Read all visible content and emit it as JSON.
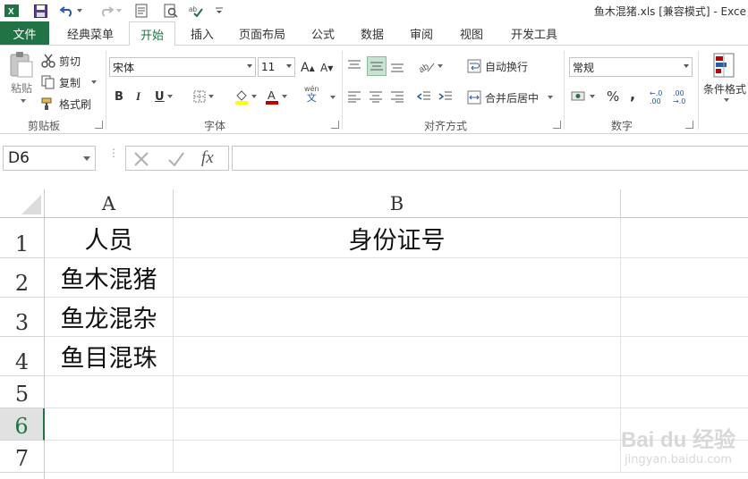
{
  "title_bar": {
    "title": "鱼木混猪.xls  [兼容模式] - Exce"
  },
  "tabs": {
    "file": "文件",
    "items": [
      "经典菜单",
      "开始",
      "插入",
      "页面布局",
      "公式",
      "数据",
      "审阅",
      "视图",
      "开发工具"
    ],
    "active_index": 1
  },
  "ribbon": {
    "clipboard": {
      "paste": "粘贴",
      "cut": "剪切",
      "copy": "复制",
      "format_painter": "格式刷",
      "group_label": "剪贴板"
    },
    "font": {
      "font_name": "宋体",
      "font_size": "11",
      "bold": "B",
      "italic": "I",
      "underline": "U",
      "group_label": "字体",
      "wen": "wén",
      "wen_char": "文"
    },
    "alignment": {
      "wrap_text": "自动换行",
      "merge_center": "合并后居中",
      "group_label": "对齐方式"
    },
    "number": {
      "format": "常规",
      "percent": "%",
      "comma": ",",
      "inc_decimal": "←.0 .00",
      "dec_decimal": ".00 →.0",
      "group_label": "数字"
    },
    "styles": {
      "conditional_format": "条件格式"
    }
  },
  "formula_bar": {
    "name_box": "D6",
    "fx": "fx",
    "formula": ""
  },
  "sheet": {
    "columns": [
      "A",
      "B"
    ],
    "rows": [
      "1",
      "2",
      "3",
      "4",
      "5",
      "6",
      "7"
    ],
    "selected_row": "6",
    "cells": {
      "A1": "人员",
      "B1": "身份证号",
      "A2": "鱼木混猪",
      "B2": "",
      "A3": "鱼龙混杂",
      "B3": "",
      "A4": "鱼目混珠",
      "B4": ""
    }
  },
  "watermark": {
    "brand": "Bai du 经验",
    "url": "jingyan.baidu.com"
  },
  "colors": {
    "excel_green": "#217346",
    "font_color_red": "#c00000",
    "fill_yellow": "#ffff00"
  }
}
